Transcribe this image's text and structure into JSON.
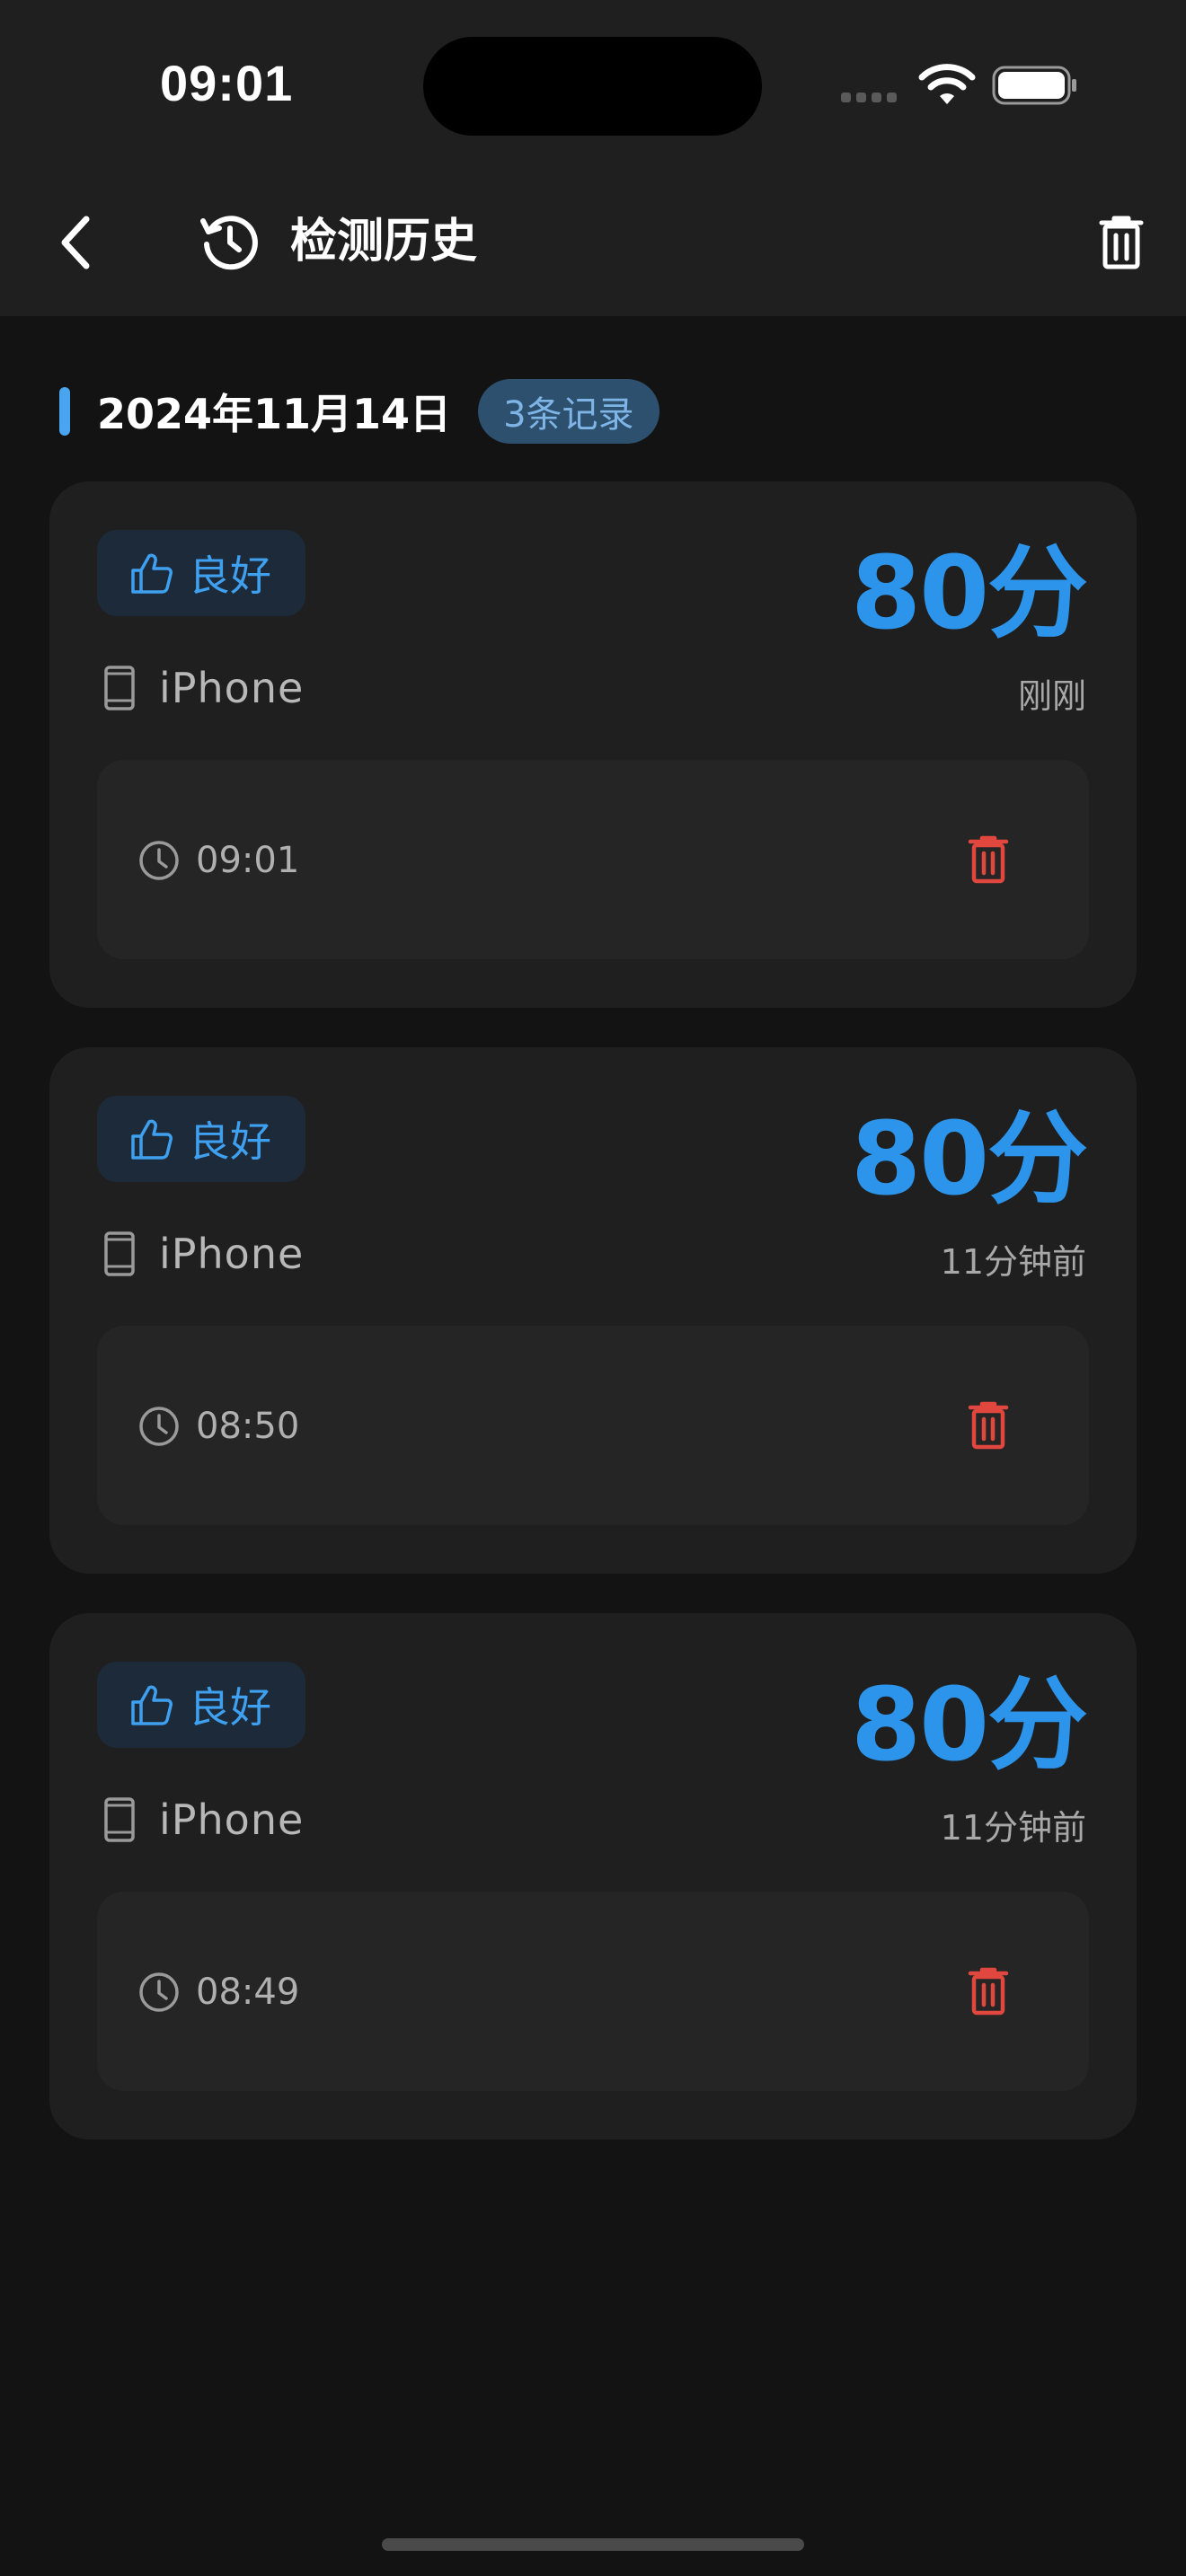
{
  "status_bar": {
    "time": "09:01",
    "icons": [
      "signal-dots-icon",
      "wifi-icon",
      "battery-icon"
    ]
  },
  "nav": {
    "back_icon": "chevron-left-icon",
    "title_icon": "history-icon",
    "title": "检测历史",
    "clear_icon": "trash-icon"
  },
  "group": {
    "date": "2024年11月14日",
    "count": "3条记录"
  },
  "records": [
    {
      "status": "良好",
      "device": "iPhone",
      "score": "80分",
      "relative_time": "刚刚",
      "time": "09:01"
    },
    {
      "status": "良好",
      "device": "iPhone",
      "score": "80分",
      "relative_time": "11分钟前",
      "time": "08:50"
    },
    {
      "status": "良好",
      "device": "iPhone",
      "score": "80分",
      "relative_time": "11分钟前",
      "time": "08:49"
    }
  ],
  "colors": {
    "background": "#131313",
    "card": "#1f1f1f",
    "inner_panel": "#252525",
    "accent_blue": "#2c94ea",
    "delete_red": "#e0473f",
    "badge_bg": "#2e506f"
  }
}
